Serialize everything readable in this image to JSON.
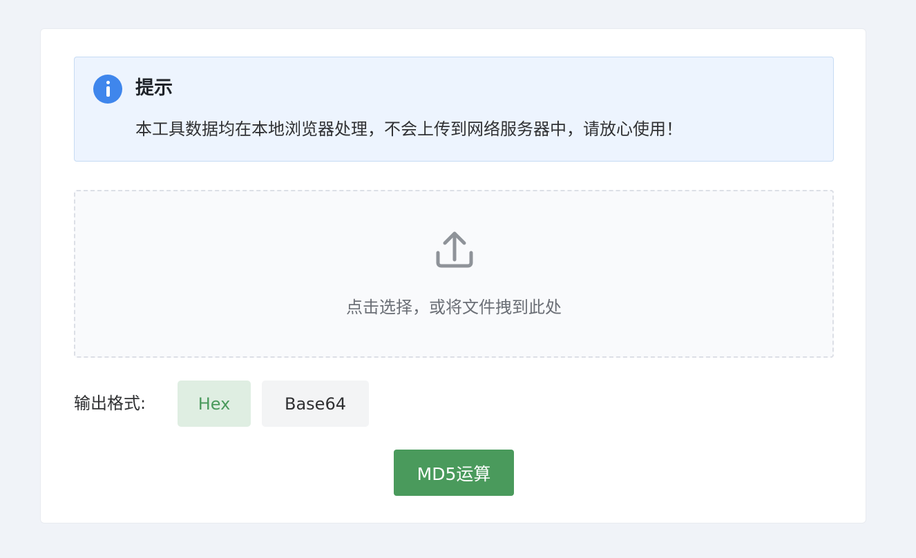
{
  "alert": {
    "icon": "info-icon",
    "title": "提示",
    "message": "本工具数据均在本地浏览器处理，不会上传到网络服务器中，请放心使用！"
  },
  "upload": {
    "icon": "upload-icon",
    "text": "点击选择，或将文件拽到此处"
  },
  "output_format": {
    "label": "输出格式:",
    "options": [
      "Hex",
      "Base64"
    ],
    "selected": "Hex"
  },
  "action": {
    "button_label": "MD5运算"
  },
  "colors": {
    "accent": "#4a9a5c",
    "info": "#3f86ec",
    "alert_bg": "#edf4fe"
  }
}
